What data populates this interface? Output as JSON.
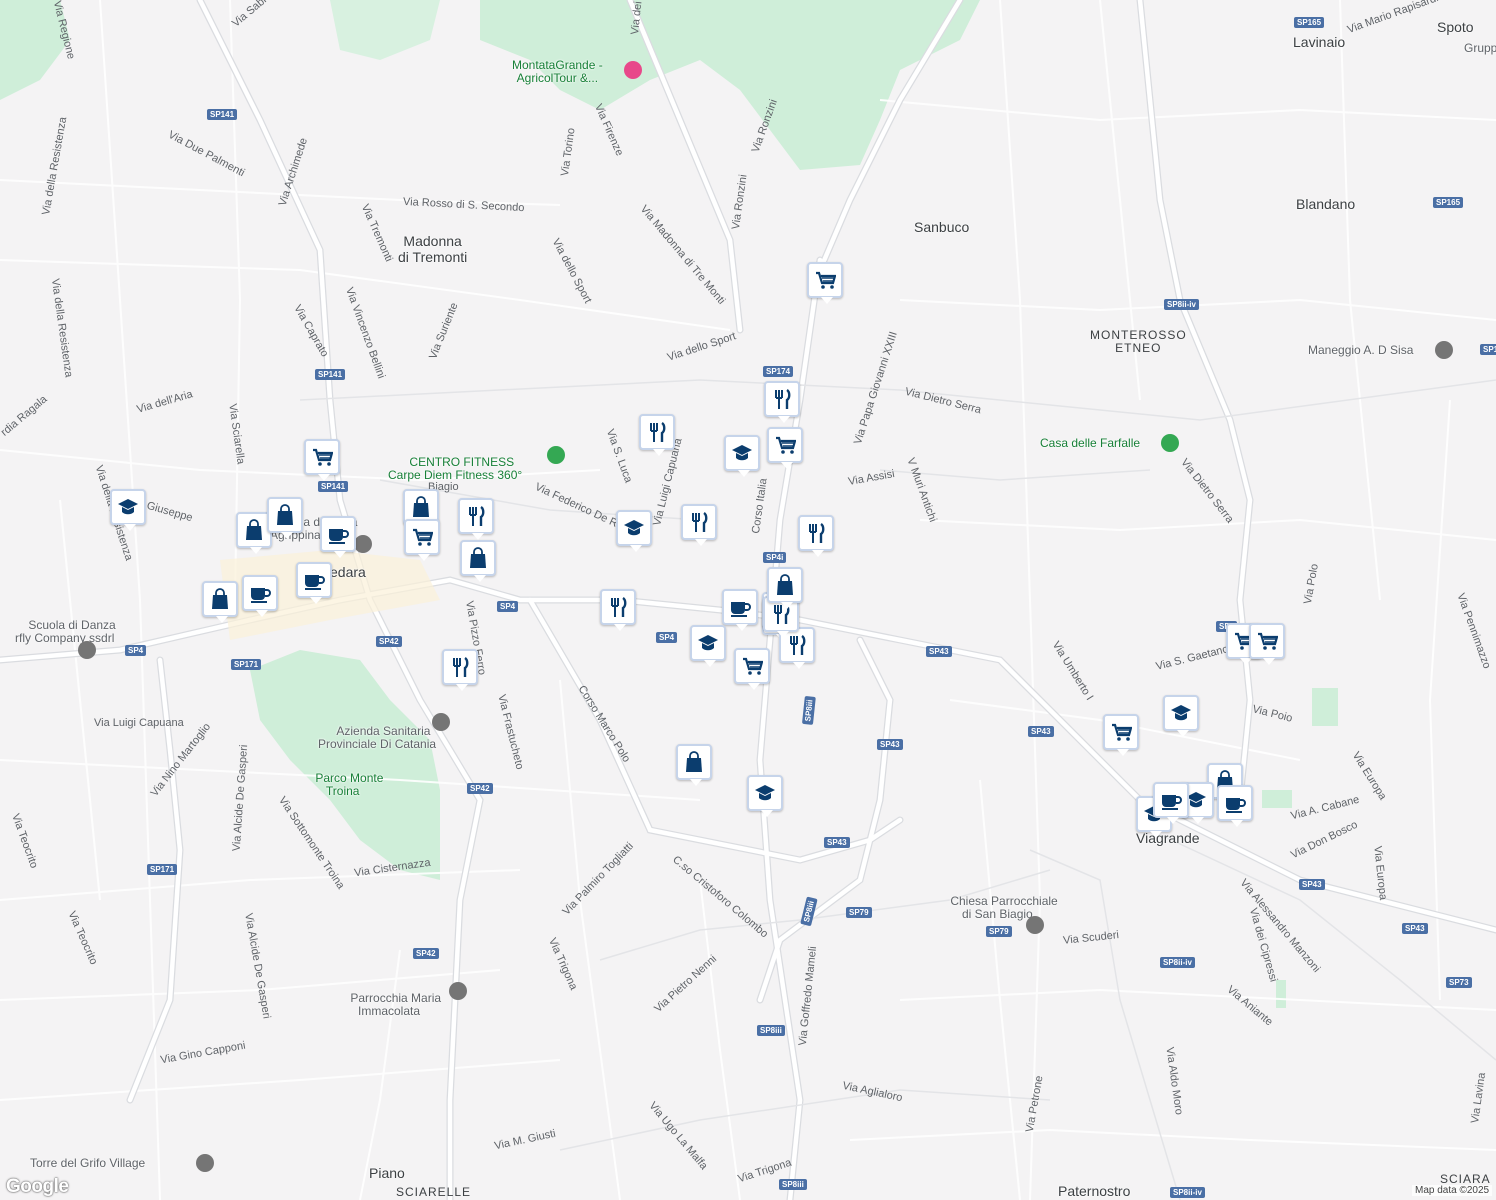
{
  "colors": {
    "background": "#f4f3f4",
    "park": "#cfeed9",
    "road": "#ffffff",
    "road_outline": "#dadce0",
    "marker_fill": "#0b3d6e",
    "marker_border": "#c6d4ea",
    "poi_green": "#188038"
  },
  "towns": [
    {
      "id": "madonna",
      "text": "Madonna\ndi Tremonti"
    },
    {
      "id": "sanbuco",
      "text": "Sanbuco"
    },
    {
      "id": "lavinaio",
      "text": "Lavinaio"
    },
    {
      "id": "spoto",
      "text": "Spoto"
    },
    {
      "id": "blandano",
      "text": "Blandano"
    },
    {
      "id": "viagrande",
      "text": "Viagrande"
    },
    {
      "id": "piano",
      "text": "Piano"
    },
    {
      "id": "paternostro",
      "text": "Paternostro"
    },
    {
      "id": "pedara",
      "text": "edara"
    }
  ],
  "caps_labels": [
    {
      "id": "monterosso",
      "text": "MONTEROSSO\nETNEO"
    },
    {
      "id": "sciarelle",
      "text": "SCIARELLE"
    },
    {
      "id": "sciara",
      "text": "SCIARA"
    }
  ],
  "pois": [
    {
      "id": "montata",
      "text": "MontataGrande -\nAgricolTour &...",
      "icon": "camera-icon"
    },
    {
      "id": "fitness",
      "text": "CENTRO FITNESS\nCarpe Diem Fitness 360°",
      "icon": "place-icon"
    },
    {
      "id": "farfalle",
      "text": "Casa delle Farfalle",
      "icon": "tree-icon"
    },
    {
      "id": "maneggio",
      "text": "Maneggio A. D Sisa",
      "icon": "place-icon"
    },
    {
      "id": "danza",
      "text": "Scuola di Danza\nrfly Company ssdrl",
      "icon": "place-icon"
    },
    {
      "id": "azienda",
      "text": "Azienda Sanitaria\nProvinciale Di Catania",
      "icon": "hospital-icon"
    },
    {
      "id": "parco",
      "text": "Parco Monte\nTroina",
      "icon": "park-icon"
    },
    {
      "id": "chiesa",
      "text": "Chiesa Parrocchiale\ndi San Biagio",
      "icon": "church-icon"
    },
    {
      "id": "parrocchia",
      "text": "Parrocchia Maria\nImmacolata",
      "icon": "church-icon"
    },
    {
      "id": "torre",
      "text": "Torre del Grifo Village",
      "icon": "place-icon"
    },
    {
      "id": "basilica",
      "text": "silica di Santa\nAgrippina",
      "icon": "church-icon"
    },
    {
      "id": "gruppo",
      "text": "Grupp",
      "icon": "place-icon"
    }
  ],
  "streets": [
    {
      "id": "s1",
      "text": "Via Sabi"
    },
    {
      "id": "s2",
      "text": "Via Due Palmenti"
    },
    {
      "id": "s3",
      "text": "Via della Resistenza"
    },
    {
      "id": "s4",
      "text": "Via della Resistenza"
    },
    {
      "id": "s5",
      "text": "Via Archimede"
    },
    {
      "id": "s6",
      "text": "Via Rosso di S. Secondo"
    },
    {
      "id": "s7",
      "text": "Via Tremonti"
    },
    {
      "id": "s8",
      "text": "Via Vincenzo Bellini"
    },
    {
      "id": "s9",
      "text": "Via Caprato"
    },
    {
      "id": "s10",
      "text": "Via Suriente"
    },
    {
      "id": "s11",
      "text": "Via dell'Aria"
    },
    {
      "id": "s12",
      "text": "Via Sciarella"
    },
    {
      "id": "s13",
      "text": "Via della Resistenza"
    },
    {
      "id": "s14",
      "text": "Via dello Sport"
    },
    {
      "id": "s15",
      "text": "Via dello Sport"
    },
    {
      "id": "s16",
      "text": "Via Madonna di Tre Monti"
    },
    {
      "id": "s17",
      "text": "Via Ronzini"
    },
    {
      "id": "s18",
      "text": "Via Ronzini"
    },
    {
      "id": "s19",
      "text": "Via Torino"
    },
    {
      "id": "s20",
      "text": "Via Firenze"
    },
    {
      "id": "s21",
      "text": "Via S. Luca"
    },
    {
      "id": "s22",
      "text": "Via Federico De Roberto"
    },
    {
      "id": "s23",
      "text": "Corso Italia"
    },
    {
      "id": "s24",
      "text": "Via Papa Giovanni XXIII"
    },
    {
      "id": "s25",
      "text": "Via Dietro Serra"
    },
    {
      "id": "s26",
      "text": "Via Assisi"
    },
    {
      "id": "s27",
      "text": "V Muri Antichi"
    },
    {
      "id": "s28",
      "text": "Via Dietro Serra"
    },
    {
      "id": "s29",
      "text": "Via Polo"
    },
    {
      "id": "s30",
      "text": "Via Umberto I"
    },
    {
      "id": "s31",
      "text": "Via S. Gaetano"
    },
    {
      "id": "s32",
      "text": "Via Poio"
    },
    {
      "id": "s33",
      "text": "Via Europa"
    },
    {
      "id": "s34",
      "text": "Via A. Cabane"
    },
    {
      "id": "s35",
      "text": "Via Don Bosco"
    },
    {
      "id": "s36",
      "text": "Via Europa"
    },
    {
      "id": "s37",
      "text": "Via Alessandro Manzoni"
    },
    {
      "id": "s38",
      "text": "Via dei Cipressi"
    },
    {
      "id": "s39",
      "text": "Via Aniante"
    },
    {
      "id": "s40",
      "text": "Via Scuderi"
    },
    {
      "id": "s41",
      "text": "Via Aldo Moro"
    },
    {
      "id": "s42",
      "text": "Via Petrone"
    },
    {
      "id": "s43",
      "text": "Via Lavina"
    },
    {
      "id": "s44",
      "text": "Via Pennimazzo"
    },
    {
      "id": "s45",
      "text": "Via Luigi Capuana"
    },
    {
      "id": "s46",
      "text": "Via Nino Martoglio"
    },
    {
      "id": "s47",
      "text": "Via Alcide De Gasperi"
    },
    {
      "id": "s48",
      "text": "Via Sottomonte Troina"
    },
    {
      "id": "s49",
      "text": "Via Cisternazza"
    },
    {
      "id": "s50",
      "text": "Via Teocrito"
    },
    {
      "id": "s51",
      "text": "Via Teocrito"
    },
    {
      "id": "s52",
      "text": "Via Alcide De Gasperi"
    },
    {
      "id": "s53",
      "text": "Via Gino Capponi"
    },
    {
      "id": "s54",
      "text": "Via Pizzo Ferro"
    },
    {
      "id": "s55",
      "text": "Via Frastucheto"
    },
    {
      "id": "s56",
      "text": "Corso Marco Polo"
    },
    {
      "id": "s57",
      "text": "Via Palmiro Togliatti"
    },
    {
      "id": "s58",
      "text": "C.so Cristoforo Colombo"
    },
    {
      "id": "s59",
      "text": "Via Trigona"
    },
    {
      "id": "s60",
      "text": "Via Pietro Nenni"
    },
    {
      "id": "s61",
      "text": "Via Goffredo Mameli"
    },
    {
      "id": "s62",
      "text": "Via Aglialoro"
    },
    {
      "id": "s63",
      "text": "Via M. Giusti"
    },
    {
      "id": "s64",
      "text": "Via Ugo La Malfa"
    },
    {
      "id": "s65",
      "text": "Via Trigona"
    },
    {
      "id": "s66",
      "text": "Via Regione"
    },
    {
      "id": "s67",
      "text": "Via dei"
    },
    {
      "id": "s68",
      "text": "Via Mario Rapisardi"
    },
    {
      "id": "s69",
      "text": "rdia Ragala"
    },
    {
      "id": "s70",
      "text": "Giuseppe"
    },
    {
      "id": "s71",
      "text": "Biagio"
    },
    {
      "id": "s72",
      "text": "Via Luigi Capuana"
    }
  ],
  "shields": [
    {
      "id": "r1",
      "text": "SP141"
    },
    {
      "id": "r2",
      "text": "SP141"
    },
    {
      "id": "r3",
      "text": "SP141"
    },
    {
      "id": "r4",
      "text": "SP165"
    },
    {
      "id": "r5",
      "text": "SP165"
    },
    {
      "id": "r6",
      "text": "SP8ii-iv"
    },
    {
      "id": "r7",
      "text": "SP174"
    },
    {
      "id": "r8",
      "text": "SP4"
    },
    {
      "id": "r9",
      "text": "SP4"
    },
    {
      "id": "r10",
      "text": "SP4i"
    },
    {
      "id": "r11",
      "text": "SP43"
    },
    {
      "id": "r12",
      "text": "SP43"
    },
    {
      "id": "r13",
      "text": "SP43"
    },
    {
      "id": "r14",
      "text": "SP43"
    },
    {
      "id": "r15",
      "text": "SP43"
    },
    {
      "id": "r16",
      "text": "SP43"
    },
    {
      "id": "r17",
      "text": "SP42"
    },
    {
      "id": "r18",
      "text": "SP42"
    },
    {
      "id": "r19",
      "text": "SP42"
    },
    {
      "id": "r20",
      "text": "SP171"
    },
    {
      "id": "r21",
      "text": "SP171"
    },
    {
      "id": "r22",
      "text": "SP4"
    },
    {
      "id": "r23",
      "text": "SP79"
    },
    {
      "id": "r24",
      "text": "SP79"
    },
    {
      "id": "r25",
      "text": "SP8iii"
    },
    {
      "id": "r26",
      "text": "SP8iii"
    },
    {
      "id": "r27",
      "text": "SP8iii"
    },
    {
      "id": "r28",
      "text": "SP8ii-iv"
    },
    {
      "id": "r29",
      "text": "SP8ii-iv"
    },
    {
      "id": "r30",
      "text": "SP73"
    },
    {
      "id": "r31",
      "text": "SP8iii"
    },
    {
      "id": "r32",
      "text": "SP1"
    },
    {
      "id": "r33",
      "text": "SP8"
    },
    {
      "id": "r34",
      "text": "SP8iii"
    }
  ],
  "markers": [
    {
      "id": "m1",
      "icon": "cart-icon"
    },
    {
      "id": "m2",
      "icon": "cart-icon"
    },
    {
      "id": "m3",
      "icon": "restaurant-icon"
    },
    {
      "id": "m4",
      "icon": "restaurant-icon"
    },
    {
      "id": "m5",
      "icon": "cart-icon"
    },
    {
      "id": "m6",
      "icon": "school-icon"
    },
    {
      "id": "m7",
      "icon": "restaurant-icon"
    },
    {
      "id": "m8",
      "icon": "restaurant-icon"
    },
    {
      "id": "m9",
      "icon": "school-icon"
    },
    {
      "id": "m10",
      "icon": "restaurant-icon"
    },
    {
      "id": "m11",
      "icon": "shopping-bag-icon"
    },
    {
      "id": "m12",
      "icon": "restaurant-icon"
    },
    {
      "id": "m13",
      "icon": "cafe-icon"
    },
    {
      "id": "m14",
      "icon": "restaurant-icon"
    },
    {
      "id": "m15",
      "icon": "restaurant-icon"
    },
    {
      "id": "m16",
      "icon": "school-icon"
    },
    {
      "id": "m17",
      "icon": "cart-icon"
    },
    {
      "id": "m18",
      "icon": "restaurant-icon"
    },
    {
      "id": "m19",
      "icon": "shopping-bag-icon"
    },
    {
      "id": "m20",
      "icon": "school-icon"
    },
    {
      "id": "m21",
      "icon": "school-icon"
    },
    {
      "id": "m22",
      "icon": "shopping-bag-icon"
    },
    {
      "id": "m23",
      "icon": "shopping-bag-icon"
    },
    {
      "id": "m24",
      "icon": "cafe-icon"
    },
    {
      "id": "m25",
      "icon": "cart-icon"
    },
    {
      "id": "m26",
      "icon": "shopping-bag-icon"
    },
    {
      "id": "m27",
      "icon": "restaurant-icon"
    },
    {
      "id": "m28",
      "icon": "cafe-icon"
    },
    {
      "id": "m29",
      "icon": "shopping-bag-icon"
    },
    {
      "id": "m30",
      "icon": "cafe-icon"
    },
    {
      "id": "m31",
      "icon": "school-icon"
    },
    {
      "id": "m32",
      "icon": "shopping-bag-icon"
    },
    {
      "id": "m33",
      "icon": "restaurant-icon"
    },
    {
      "id": "m34",
      "icon": "cart-icon"
    },
    {
      "id": "m35",
      "icon": "cart-icon"
    },
    {
      "id": "m36",
      "icon": "school-icon"
    },
    {
      "id": "m37",
      "icon": "cart-icon"
    },
    {
      "id": "m38",
      "icon": "shopping-bag-icon"
    },
    {
      "id": "m39",
      "icon": "cafe-icon"
    },
    {
      "id": "m40",
      "icon": "school-icon"
    },
    {
      "id": "m41",
      "icon": "cafe-icon"
    }
  ],
  "brand": "Google",
  "attribution": "Map data ©2025"
}
